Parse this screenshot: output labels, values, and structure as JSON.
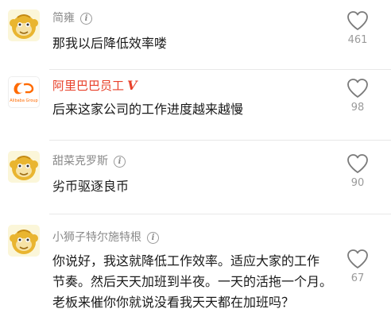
{
  "comments": [
    {
      "username": "简雍",
      "text_lines": [
        "那我以后降低效率喽"
      ],
      "likes": "461",
      "avatar_icon": "monkey-avatar-icon"
    },
    {
      "username": "阿里巴巴员工",
      "verified_mark": "V",
      "avatar_logo_text": "Alibaba Group",
      "text_lines": [
        "后来这家公司的工作进度越来越慢"
      ],
      "likes": "98",
      "avatar_icon": "alibaba-logo-icon"
    },
    {
      "username": "甜菜克罗斯",
      "text_lines": [
        "劣币驱逐良币"
      ],
      "likes": "90",
      "avatar_icon": "monkey-avatar-icon"
    },
    {
      "username": "小狮子特尔施特根",
      "text_lines": [
        "你说好，我这就降低工作效率。适应大家的工作",
        "节奏。然后天天加班到半夜。一天的活拖一个月。",
        "老板来催你你就说没看我天天都在加班吗？"
      ],
      "likes": "67",
      "avatar_icon": "monkey-avatar-icon"
    }
  ],
  "info_icon_glyph": "i",
  "colors": {
    "verified_name": "#e8402a",
    "username": "#8a8a8a",
    "like_count": "#9a9a9a",
    "divider": "#e8e8e8"
  }
}
